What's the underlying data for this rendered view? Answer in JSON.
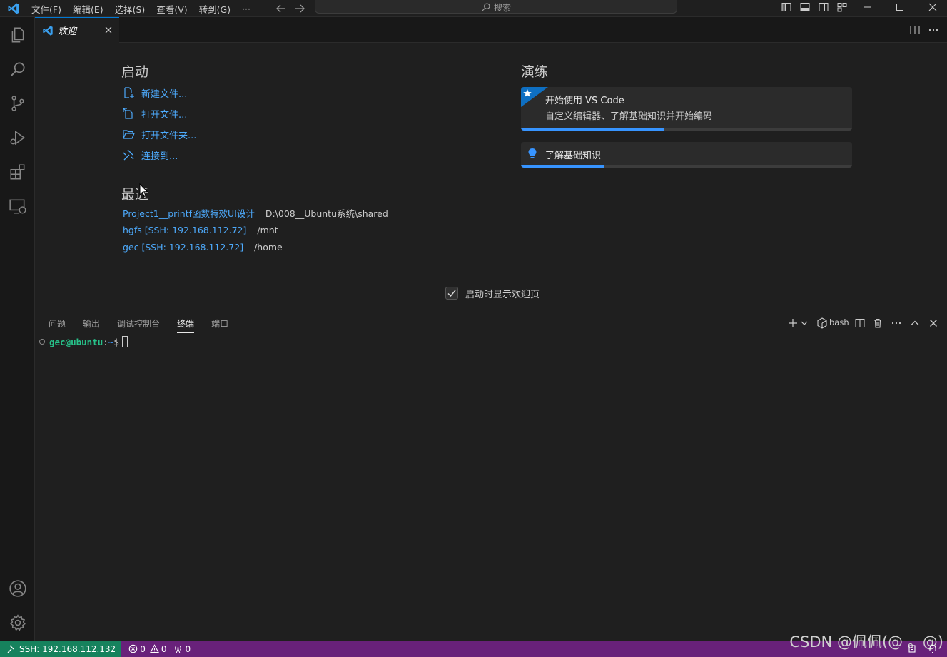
{
  "titlebar": {
    "menu": [
      "文件(F)",
      "编辑(E)",
      "选择(S)",
      "查看(V)",
      "转到(G)",
      "···"
    ],
    "search_placeholder": "搜索"
  },
  "activity_bar": [
    "explorer-icon",
    "search-icon",
    "source-control-icon",
    "run-debug-icon",
    "extensions-icon",
    "remote-explorer-icon",
    "account-icon",
    "settings-gear-icon"
  ],
  "tabs": [
    {
      "label": "欢迎",
      "active": true
    }
  ],
  "welcome": {
    "start": {
      "heading": "启动",
      "items": [
        {
          "label": "新建文件...",
          "icon": "new-file-icon"
        },
        {
          "label": "打开文件...",
          "icon": "open-file-icon"
        },
        {
          "label": "打开文件夹...",
          "icon": "open-folder-icon"
        },
        {
          "label": "连接到...",
          "icon": "remote-connect-icon"
        }
      ]
    },
    "recent": {
      "heading": "最近",
      "items": [
        {
          "name": "Project1__printf函数特效UI设计",
          "path": "D:\\008__Ubuntu系统\\shared"
        },
        {
          "name": "hgfs [SSH: 192.168.112.72]",
          "path": "/mnt"
        },
        {
          "name": "gec [SSH: 192.168.112.72]",
          "path": "/home"
        }
      ]
    },
    "walkthroughs": {
      "heading": "演练",
      "items": [
        {
          "title": "开始使用 VS Code",
          "description": "自定义编辑器、了解基础知识并开始编码",
          "progress": 0.43,
          "icon": "star-badge-icon"
        },
        {
          "title": "了解基础知识",
          "progress": 0.25,
          "icon": "lightbulb-icon"
        }
      ]
    },
    "show_on_startup": {
      "label": "启动时显示欢迎页",
      "checked": true
    }
  },
  "panel": {
    "tabs": [
      "问题",
      "输出",
      "调试控制台",
      "终端",
      "端口"
    ],
    "active_tab": "终端",
    "terminal_name": "bash",
    "prompt": {
      "user_host": "gec@ubuntu",
      "sep": ":",
      "path": "~",
      "symbol": "$"
    }
  },
  "statusbar": {
    "remote": "SSH: 192.168.112.132",
    "errors": "0",
    "warnings": "0",
    "ports": "0",
    "watermark": "CSDN @佩佩(@  。@)",
    "remote_color": "#16825d",
    "background": "#68217a"
  },
  "accent": "#0078d4",
  "link_color": "#4daafc"
}
